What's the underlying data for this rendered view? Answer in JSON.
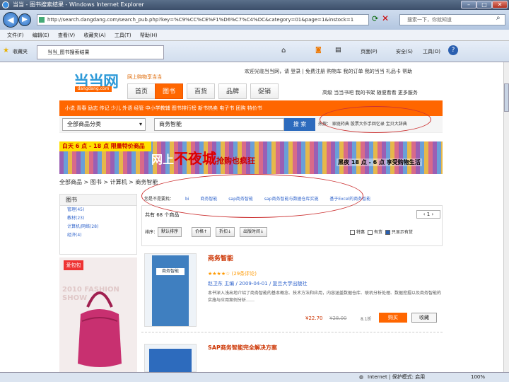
{
  "window": {
    "title": "当当 - 图书搜索结果 - Windows Internet Explorer",
    "min": "–",
    "max": "□",
    "close": "✕"
  },
  "address": {
    "url": "http://search.dangdang.com/search_pub.php?key=%C9%CC%CE%F1%D6%C7%C4%DC&category=01&page=1&instock=1",
    "search_placeholder": "搜索一下，你就知道"
  },
  "menu": [
    "文件(F)",
    "编辑(E)",
    "查看(V)",
    "收藏夹(A)",
    "工具(T)",
    "帮助(H)"
  ],
  "favorites": {
    "label": "收藏夹",
    "tab": "当当_图书搜索结果"
  },
  "ie_tools": [
    "页面(P)",
    "安全(S)",
    "工具(O)"
  ],
  "site": {
    "logo": "当当网",
    "logo_sub": "dangdang.com",
    "slogan": "网上购物享当当",
    "toplinks": "欢迎光临当当网，请 登录 | 免费注册    购物车  我的订单  我的当当  礼品卡  帮助",
    "tabs": [
      "首页",
      "图书",
      "百货",
      "品牌",
      "促销"
    ],
    "rightlinks": "高级  当当书吧  我的书架  随便看看  更多服务",
    "orange_nav": "小说  青春  励志  传记  少儿  外语  经管  中小学教辅  图书排行榜  新书热卖  电子书  团购  特价书",
    "category": "全部商品分类",
    "query": "商务智能",
    "search_btn": "搜 索",
    "hot": "热搜：  家庭药典  股票大作手回忆录  宝贝大辞典"
  },
  "banner": {
    "b1": "白天 6 点 - 18 点  限量特价商品",
    "b2_pre": "网上",
    "b2_big": "不夜城",
    "b2_post": "抢购也疯狂",
    "b3": "黑夜 18 点 - 6 点  享受购物生活"
  },
  "breadcrumb": "全部商品 > 图书 > 计算机 > 商务智能",
  "filters": [
    "您是不是要找：",
    "bi",
    "商务智能",
    "sap商务智能",
    "sap商务智能与数据仓库实施",
    "基于Excel的商务智能"
  ],
  "left_panel": {
    "title": "图书",
    "items": [
      "管理(45)",
      "教材(23)",
      "计算机/网络(28)",
      "经济(4)"
    ]
  },
  "results": {
    "count": "共有 68 个商品",
    "pager": "1",
    "sort_label": "排序：",
    "sort": [
      "默认排序",
      "价格↑",
      "折扣↓",
      "出版时间↓"
    ],
    "opts": [
      "特惠",
      "有货",
      "只显示有货"
    ]
  },
  "ad": {
    "tag": "爱包包",
    "watermark": "2010 FASHION SHOW"
  },
  "product": {
    "title": "商务智能",
    "cover": "商务智能",
    "stars": "★★★★☆ (29条评论)",
    "meta": "赵卫东  主编 / 2009-04-01 / 复旦大学出版社",
    "desc": "本书深入浅出地介绍了商务智能的基本概念、技术方法和应用，内容涵盖数据仓库、联机分析处理、数据挖掘以及商务智能的实施与应用案例分析……",
    "price": "¥22.70",
    "old_price": "¥28.00",
    "discount": "8.1折",
    "buy": "购买",
    "fav": "收藏"
  },
  "product2": {
    "title": "SAP商务智能完全解决方案"
  },
  "status": {
    "zone": "Internet | 保护模式: 启用",
    "zoom": "100%"
  }
}
